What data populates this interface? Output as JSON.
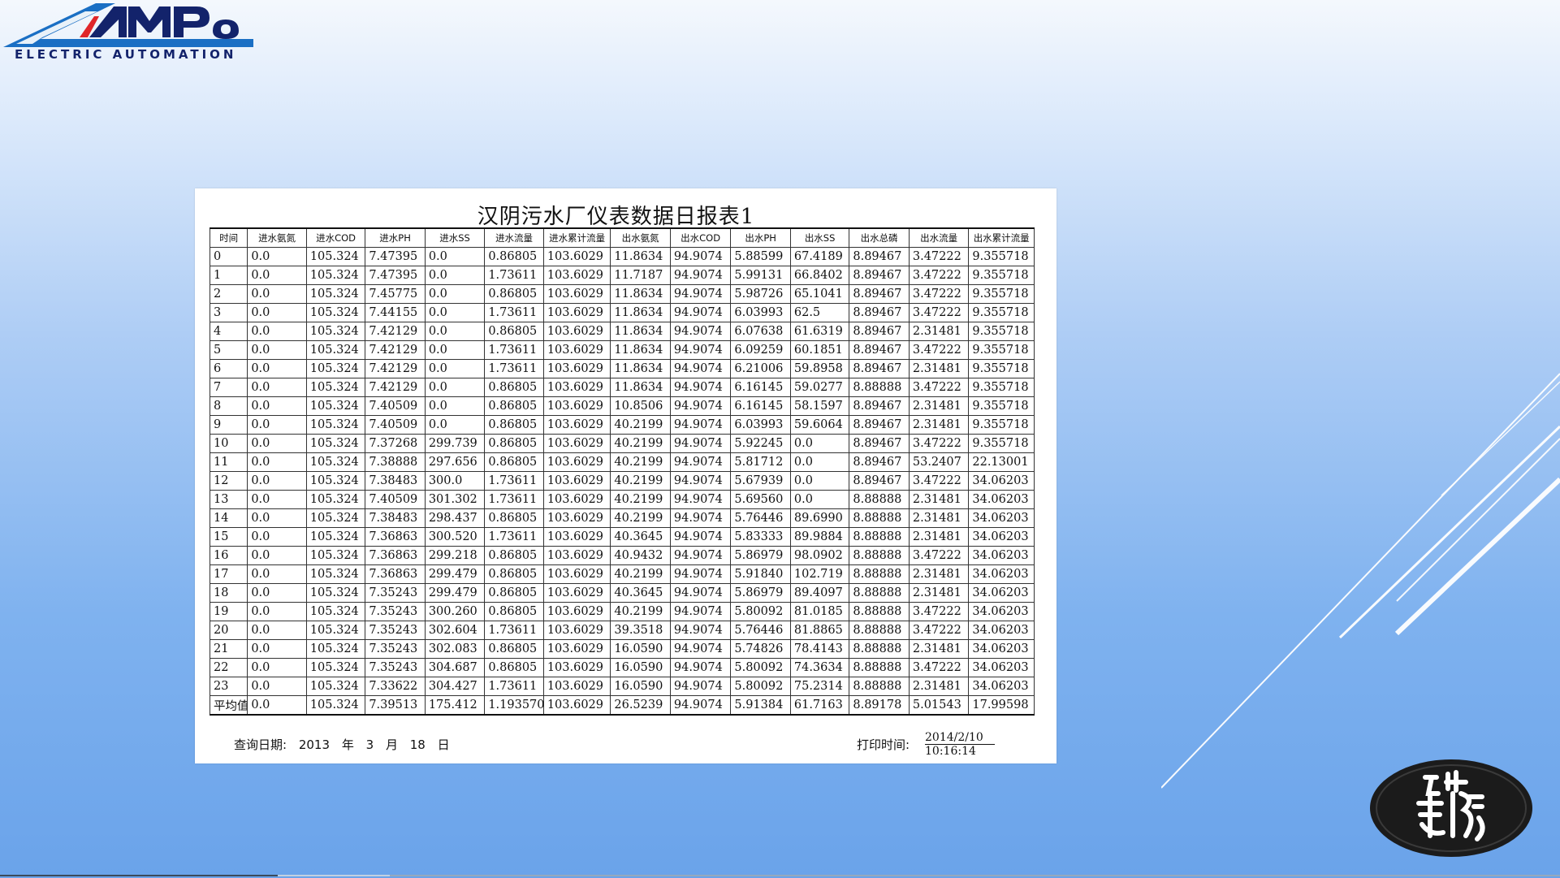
{
  "logo": {
    "text": "ELECTRIC AUTOMATION",
    "brand_mark": "AMPO"
  },
  "report": {
    "title": "汉阴污水厂仪表数据日报表1",
    "columns": [
      "时间",
      "进水氨氮",
      "进水COD",
      "进水PH",
      "进水SS",
      "进水流量",
      "进水累计流量",
      "出水氨氮",
      "出水COD",
      "出水PH",
      "出水SS",
      "出水总磷",
      "出水流量",
      "出水累计流量"
    ],
    "rows": [
      [
        "0",
        "0.0",
        "105.324",
        "7.47395",
        "0.0",
        "0.86805",
        "103.6029",
        "11.8634",
        "94.9074",
        "5.88599",
        "67.4189",
        "8.89467",
        "3.47222",
        "9.355718"
      ],
      [
        "1",
        "0.0",
        "105.324",
        "7.47395",
        "0.0",
        "1.73611",
        "103.6029",
        "11.7187",
        "94.9074",
        "5.99131",
        "66.8402",
        "8.89467",
        "3.47222",
        "9.355718"
      ],
      [
        "2",
        "0.0",
        "105.324",
        "7.45775",
        "0.0",
        "0.86805",
        "103.6029",
        "11.8634",
        "94.9074",
        "5.98726",
        "65.1041",
        "8.89467",
        "3.47222",
        "9.355718"
      ],
      [
        "3",
        "0.0",
        "105.324",
        "7.44155",
        "0.0",
        "1.73611",
        "103.6029",
        "11.8634",
        "94.9074",
        "6.03993",
        "62.5",
        "8.89467",
        "3.47222",
        "9.355718"
      ],
      [
        "4",
        "0.0",
        "105.324",
        "7.42129",
        "0.0",
        "0.86805",
        "103.6029",
        "11.8634",
        "94.9074",
        "6.07638",
        "61.6319",
        "8.89467",
        "2.31481",
        "9.355718"
      ],
      [
        "5",
        "0.0",
        "105.324",
        "7.42129",
        "0.0",
        "1.73611",
        "103.6029",
        "11.8634",
        "94.9074",
        "6.09259",
        "60.1851",
        "8.89467",
        "3.47222",
        "9.355718"
      ],
      [
        "6",
        "0.0",
        "105.324",
        "7.42129",
        "0.0",
        "1.73611",
        "103.6029",
        "11.8634",
        "94.9074",
        "6.21006",
        "59.8958",
        "8.89467",
        "2.31481",
        "9.355718"
      ],
      [
        "7",
        "0.0",
        "105.324",
        "7.42129",
        "0.0",
        "0.86805",
        "103.6029",
        "11.8634",
        "94.9074",
        "6.16145",
        "59.0277",
        "8.88888",
        "3.47222",
        "9.355718"
      ],
      [
        "8",
        "0.0",
        "105.324",
        "7.40509",
        "0.0",
        "0.86805",
        "103.6029",
        "10.8506",
        "94.9074",
        "6.16145",
        "58.1597",
        "8.89467",
        "2.31481",
        "9.355718"
      ],
      [
        "9",
        "0.0",
        "105.324",
        "7.40509",
        "0.0",
        "0.86805",
        "103.6029",
        "40.2199",
        "94.9074",
        "6.03993",
        "59.6064",
        "8.89467",
        "2.31481",
        "9.355718"
      ],
      [
        "10",
        "0.0",
        "105.324",
        "7.37268",
        "299.739",
        "0.86805",
        "103.6029",
        "40.2199",
        "94.9074",
        "5.92245",
        "0.0",
        "8.89467",
        "3.47222",
        "9.355718"
      ],
      [
        "11",
        "0.0",
        "105.324",
        "7.38888",
        "297.656",
        "0.86805",
        "103.6029",
        "40.2199",
        "94.9074",
        "5.81712",
        "0.0",
        "8.89467",
        "53.2407",
        "22.13001"
      ],
      [
        "12",
        "0.0",
        "105.324",
        "7.38483",
        "300.0",
        "1.73611",
        "103.6029",
        "40.2199",
        "94.9074",
        "5.67939",
        "0.0",
        "8.89467",
        "3.47222",
        "34.06203"
      ],
      [
        "13",
        "0.0",
        "105.324",
        "7.40509",
        "301.302",
        "1.73611",
        "103.6029",
        "40.2199",
        "94.9074",
        "5.69560",
        "0.0",
        "8.88888",
        "2.31481",
        "34.06203"
      ],
      [
        "14",
        "0.0",
        "105.324",
        "7.38483",
        "298.437",
        "0.86805",
        "103.6029",
        "40.2199",
        "94.9074",
        "5.76446",
        "89.6990",
        "8.88888",
        "2.31481",
        "34.06203"
      ],
      [
        "15",
        "0.0",
        "105.324",
        "7.36863",
        "300.520",
        "1.73611",
        "103.6029",
        "40.3645",
        "94.9074",
        "5.83333",
        "89.9884",
        "8.88888",
        "2.31481",
        "34.06203"
      ],
      [
        "16",
        "0.0",
        "105.324",
        "7.36863",
        "299.218",
        "0.86805",
        "103.6029",
        "40.9432",
        "94.9074",
        "5.86979",
        "98.0902",
        "8.88888",
        "3.47222",
        "34.06203"
      ],
      [
        "17",
        "0.0",
        "105.324",
        "7.36863",
        "299.479",
        "0.86805",
        "103.6029",
        "40.2199",
        "94.9074",
        "5.91840",
        "102.719",
        "8.88888",
        "2.31481",
        "34.06203"
      ],
      [
        "18",
        "0.0",
        "105.324",
        "7.35243",
        "299.479",
        "0.86805",
        "103.6029",
        "40.3645",
        "94.9074",
        "5.86979",
        "89.4097",
        "8.88888",
        "2.31481",
        "34.06203"
      ],
      [
        "19",
        "0.0",
        "105.324",
        "7.35243",
        "300.260",
        "0.86805",
        "103.6029",
        "40.2199",
        "94.9074",
        "5.80092",
        "81.0185",
        "8.88888",
        "3.47222",
        "34.06203"
      ],
      [
        "20",
        "0.0",
        "105.324",
        "7.35243",
        "302.604",
        "1.73611",
        "103.6029",
        "39.3518",
        "94.9074",
        "5.76446",
        "81.8865",
        "8.88888",
        "3.47222",
        "34.06203"
      ],
      [
        "21",
        "0.0",
        "105.324",
        "7.35243",
        "302.083",
        "0.86805",
        "103.6029",
        "16.0590",
        "94.9074",
        "5.74826",
        "78.4143",
        "8.88888",
        "2.31481",
        "34.06203"
      ],
      [
        "22",
        "0.0",
        "105.324",
        "7.35243",
        "304.687",
        "0.86805",
        "103.6029",
        "16.0590",
        "94.9074",
        "5.80092",
        "74.3634",
        "8.88888",
        "3.47222",
        "34.06203"
      ],
      [
        "23",
        "0.0",
        "105.324",
        "7.33622",
        "304.427",
        "1.73611",
        "103.6029",
        "16.0590",
        "94.9074",
        "5.80092",
        "75.2314",
        "8.88888",
        "2.31481",
        "34.06203"
      ],
      [
        "平均值",
        "0.0",
        "105.324",
        "7.39513",
        "175.412",
        "1.193570",
        "103.6029",
        "26.5239",
        "94.9074",
        "5.91384",
        "61.7163",
        "8.89178",
        "5.01543",
        "17.99598"
      ]
    ],
    "query_label": "查询日期:",
    "query_year": "2013",
    "year_unit": "年",
    "query_month": "3",
    "month_unit": "月",
    "query_day": "18",
    "day_unit": "日",
    "print_label": "打印时间:",
    "print_date": "2014/2/10",
    "print_time": "10:16:14"
  }
}
